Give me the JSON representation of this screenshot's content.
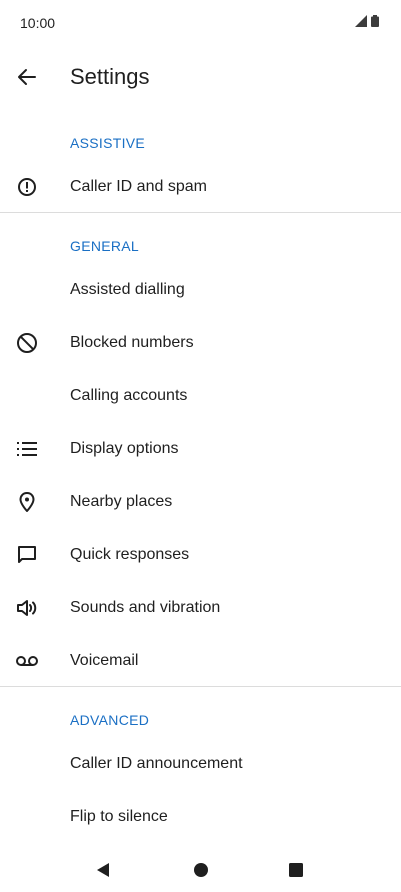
{
  "status_bar": {
    "time": "10:00",
    "icons": [
      "cell-signal-icon",
      "battery-icon"
    ]
  },
  "app_bar": {
    "back_icon": "arrow-back-icon",
    "title": "Settings"
  },
  "sections": {
    "assistive": {
      "header": "ASSISTIVE",
      "items": [
        {
          "label": "Caller ID and spam",
          "icon": "alert-circle-icon"
        }
      ]
    },
    "general": {
      "header": "GENERAL",
      "items": [
        {
          "label": "Assisted dialling",
          "icon": ""
        },
        {
          "label": "Blocked numbers",
          "icon": "block-icon"
        },
        {
          "label": "Calling accounts",
          "icon": ""
        },
        {
          "label": "Display options",
          "icon": "list-icon"
        },
        {
          "label": "Nearby places",
          "icon": "location-pin-icon"
        },
        {
          "label": "Quick responses",
          "icon": "message-icon"
        },
        {
          "label": "Sounds and vibration",
          "icon": "volume-icon"
        },
        {
          "label": "Voicemail",
          "icon": "voicemail-icon"
        }
      ]
    },
    "advanced": {
      "header": "ADVANCED",
      "items": [
        {
          "label": "Caller ID announcement",
          "icon": ""
        },
        {
          "label": "Flip to silence",
          "icon": ""
        }
      ]
    }
  },
  "nav_bar": {
    "buttons": [
      "back-triangle-icon",
      "home-circle-icon",
      "recents-square-icon"
    ]
  },
  "colors": {
    "section_header": "#1a6fc4",
    "text": "#1f1f1f",
    "divider": "#dcdcdc"
  }
}
